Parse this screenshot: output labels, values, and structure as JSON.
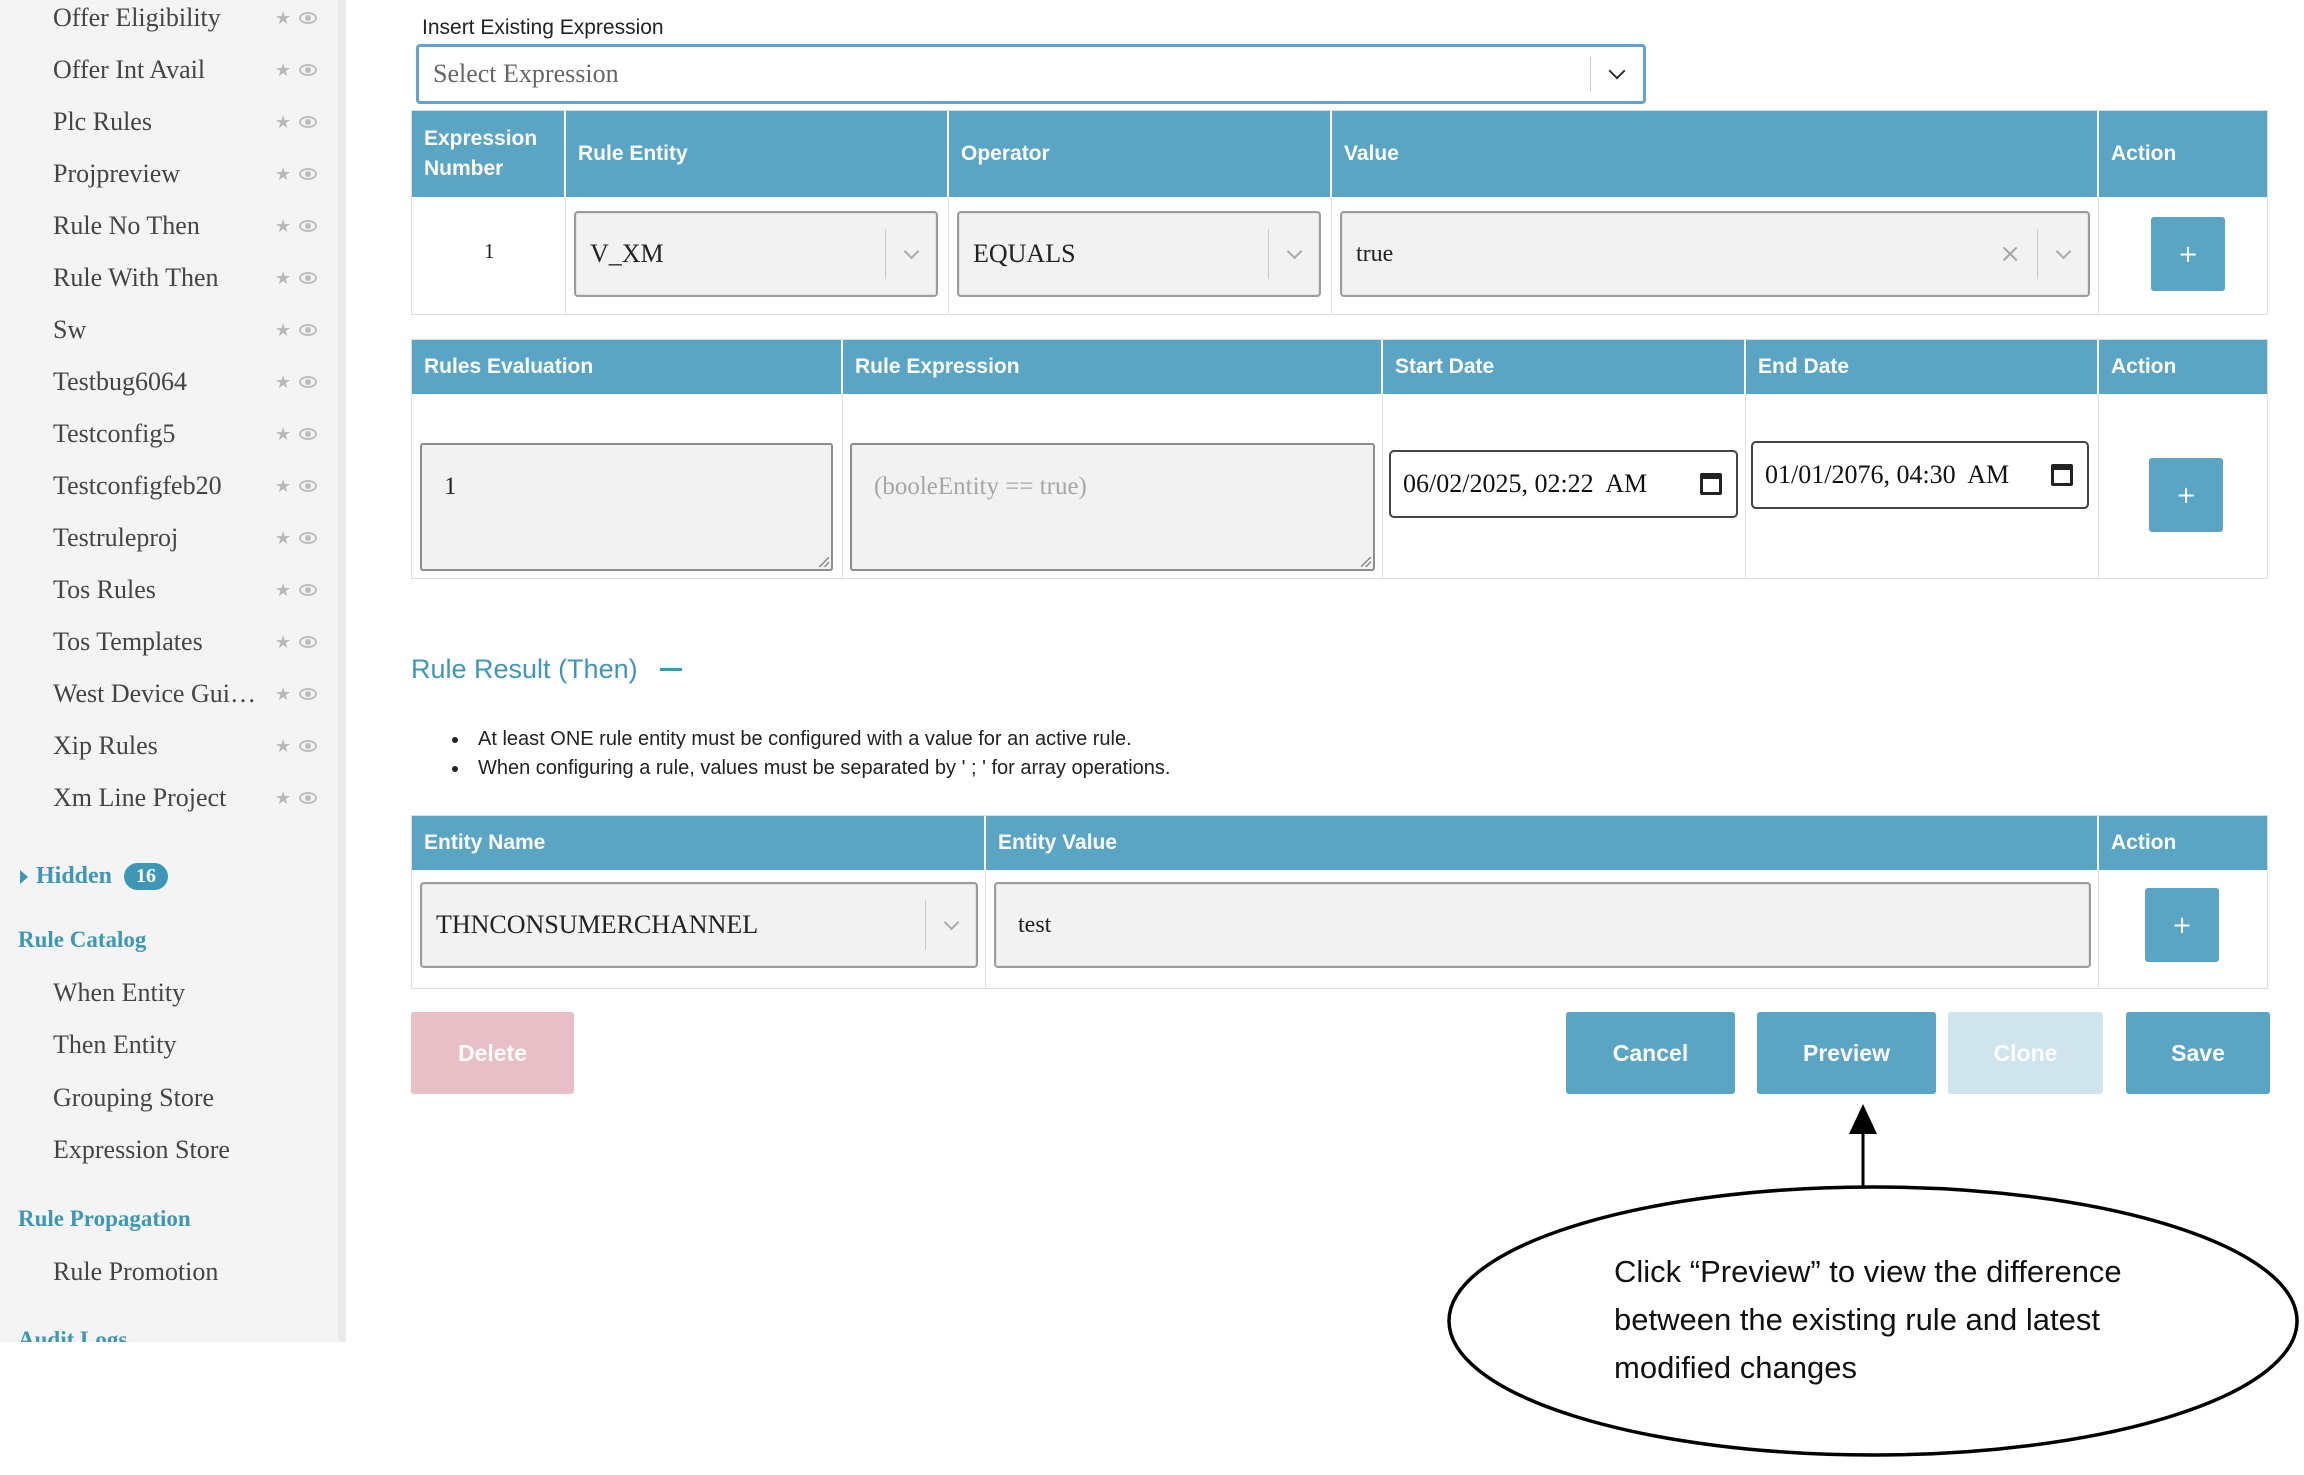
{
  "sidebar": {
    "projects": [
      "Offer Eligibility",
      "Offer Int Avail",
      "Plc Rules",
      "Projpreview",
      "Rule No Then",
      "Rule With Then",
      "Sw",
      "Testbug6064",
      "Testconfig5",
      "Testconfigfeb20",
      "Testruleproj",
      "Tos Rules",
      "Tos Templates",
      "West Device Gui…",
      "Xip Rules",
      "Xm Line Project"
    ],
    "hidden_label": "Hidden",
    "hidden_count": "16",
    "rule_catalog": {
      "title": "Rule Catalog",
      "items": [
        "When Entity",
        "Then Entity",
        "Grouping Store",
        "Expression Store"
      ]
    },
    "rule_propagation": {
      "title": "Rule Propagation",
      "items": [
        "Rule Promotion"
      ]
    },
    "audit_logs": "Audit Logs"
  },
  "expression": {
    "label": "Insert Existing Expression",
    "placeholder": "Select Expression"
  },
  "expr_table": {
    "headers": [
      "Expression Number",
      "Rule Entity",
      "Operator",
      "Value",
      "Action"
    ],
    "row": {
      "number": "1",
      "rule_entity": "V_XM",
      "operator": "EQUALS",
      "value": "true",
      "action": "+"
    }
  },
  "eval_table": {
    "headers": [
      "Rules Evaluation",
      "Rule Expression",
      "Start Date",
      "End Date",
      "Action"
    ],
    "row": {
      "evaluation": "1",
      "expression_placeholder": "(booleEntity == true)",
      "start_date": "06/02/2025, 02:22  AM",
      "end_date": "01/01/2076, 04:30  AM",
      "action": "+"
    }
  },
  "then_section": {
    "title": "Rule Result (Then)",
    "notes": [
      "At least ONE rule entity must be configured with a value for an active rule.",
      "When configuring a rule, values must be separated by ' ; ' for array operations."
    ]
  },
  "then_table": {
    "headers": [
      "Entity Name",
      "Entity Value",
      "Action"
    ],
    "row": {
      "entity_name": "THNCONSUMERCHANNEL",
      "entity_value": "test",
      "action": "+"
    }
  },
  "buttons": {
    "delete": "Delete",
    "cancel": "Cancel",
    "preview": "Preview",
    "clone": "Clone",
    "save": "Save"
  },
  "colors": {
    "primary": "#5aa5c3",
    "delete_disabled": "#e8bfc6",
    "clone_disabled": "#cfe4ec",
    "link": "#3f97b6"
  },
  "annotation": {
    "text": "Click “Preview” to view the difference between the existing rule and latest modified changes"
  }
}
